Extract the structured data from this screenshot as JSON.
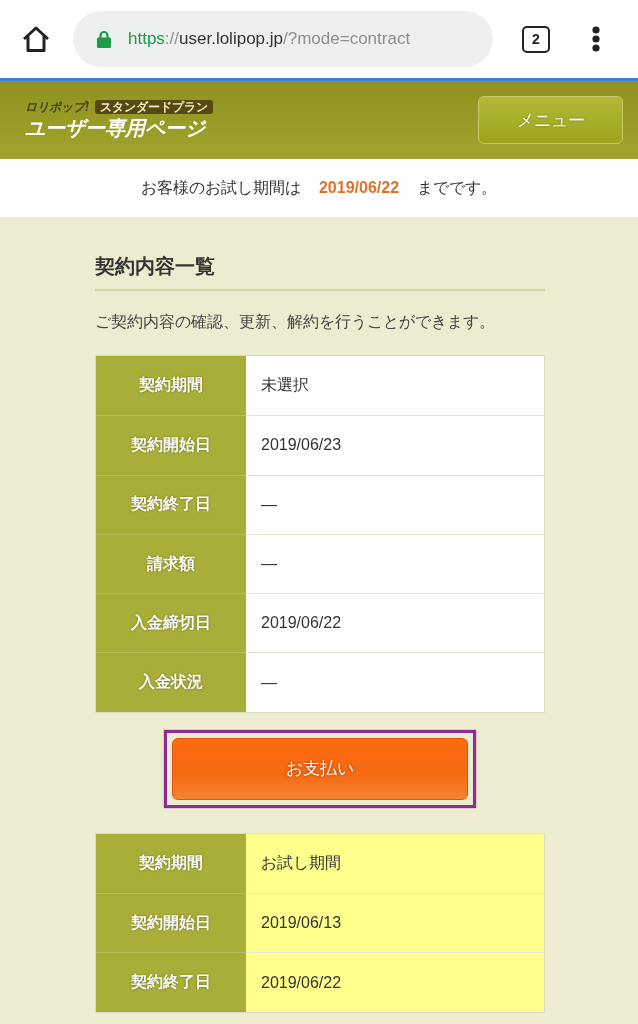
{
  "browser": {
    "url_parts": [
      {
        "kind": "scheme",
        "text": "https"
      },
      {
        "kind": "muted",
        "text": "://"
      },
      {
        "kind": "host",
        "text": "user.lolipop.jp"
      },
      {
        "kind": "muted",
        "text": "/?mode=contract"
      }
    ],
    "tab_count": "2"
  },
  "header": {
    "brand": "ロリポップ!",
    "plan": "スタンダードプラン",
    "title": "ユーザー専用ページ",
    "menu_button": "メニュー"
  },
  "notice": {
    "text_before": "お客様のお試し期間は",
    "date": "2019/06/22",
    "text_after": "までです。"
  },
  "section": {
    "title": "契約内容一覧",
    "description": "ご契約内容の確認、更新、解約を行うことができます。"
  },
  "content": [
    {
      "kind": "table",
      "highlighted": false,
      "rows": [
        {
          "label": "契約期間",
          "value": "未選択"
        },
        {
          "label": "契約開始日",
          "value": "2019/06/23"
        },
        {
          "label": "契約終了日",
          "value": "—"
        },
        {
          "label": "請求額",
          "value": "—"
        },
        {
          "label": "入金締切日",
          "value": "2019/06/22"
        },
        {
          "label": "入金状況",
          "value": "—"
        }
      ]
    },
    {
      "kind": "button",
      "label": "お支払い",
      "highlighted": true
    },
    {
      "kind": "table",
      "highlighted": true,
      "rows": [
        {
          "label": "契約期間",
          "value": "お試し期間"
        },
        {
          "label": "契約開始日",
          "value": "2019/06/13"
        },
        {
          "label": "契約終了日",
          "value": "2019/06/22"
        }
      ]
    }
  ]
}
